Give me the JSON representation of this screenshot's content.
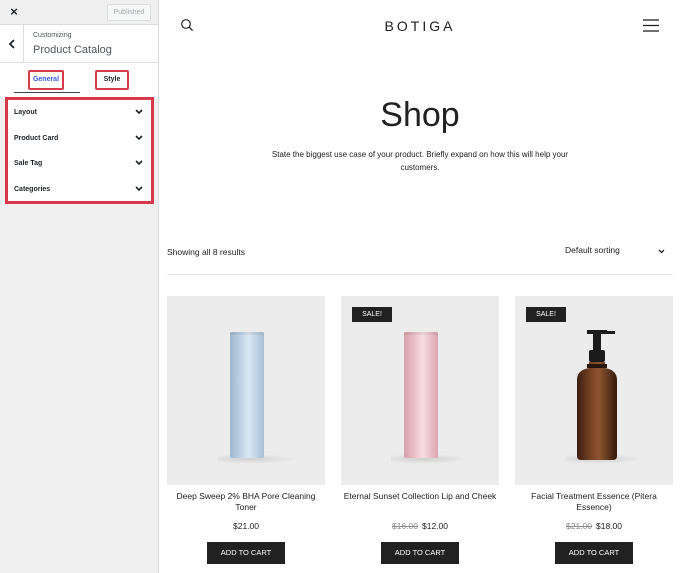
{
  "sidebar": {
    "close_label": "×",
    "published_label": "Published",
    "breadcrumb_small": "Customizing",
    "breadcrumb_title": "Product Catalog",
    "tabs": [
      {
        "label": "General",
        "active": true
      },
      {
        "label": "Style",
        "active": false
      }
    ],
    "sections": [
      {
        "label": "Layout"
      },
      {
        "label": "Product Card"
      },
      {
        "label": "Sale Tag"
      },
      {
        "label": "Categories"
      }
    ],
    "highlight_color": "#d63a4a"
  },
  "header": {
    "logo": "BOTIGA",
    "icons": [
      "search-icon",
      "hamburger-menu-icon"
    ]
  },
  "shop": {
    "title": "Shop",
    "description": "State the biggest use case of your product. Briefly expand on how this will help your customers.",
    "results_text": "Showing all 8 results",
    "sorting_value": "Default sorting"
  },
  "products": [
    {
      "name": "Deep Sweep 2% BHA Pore Cleaning Toner",
      "price": "$21.00",
      "old_price": "",
      "sale_badge": "",
      "button": "ADD TO CART",
      "image": "blue-bottle"
    },
    {
      "name": "Eternal Sunset Collection Lip and Cheek",
      "price": "$12.00",
      "old_price": "$16.00",
      "sale_badge": "SALE!",
      "button": "ADD TO CART",
      "image": "pink-bottle"
    },
    {
      "name": "Facial Treatment Essence (Pitera Essence)",
      "price": "$18.00",
      "old_price": "$21.00",
      "sale_badge": "SALE!",
      "button": "ADD TO CART",
      "image": "amber-pump-bottle"
    }
  ]
}
